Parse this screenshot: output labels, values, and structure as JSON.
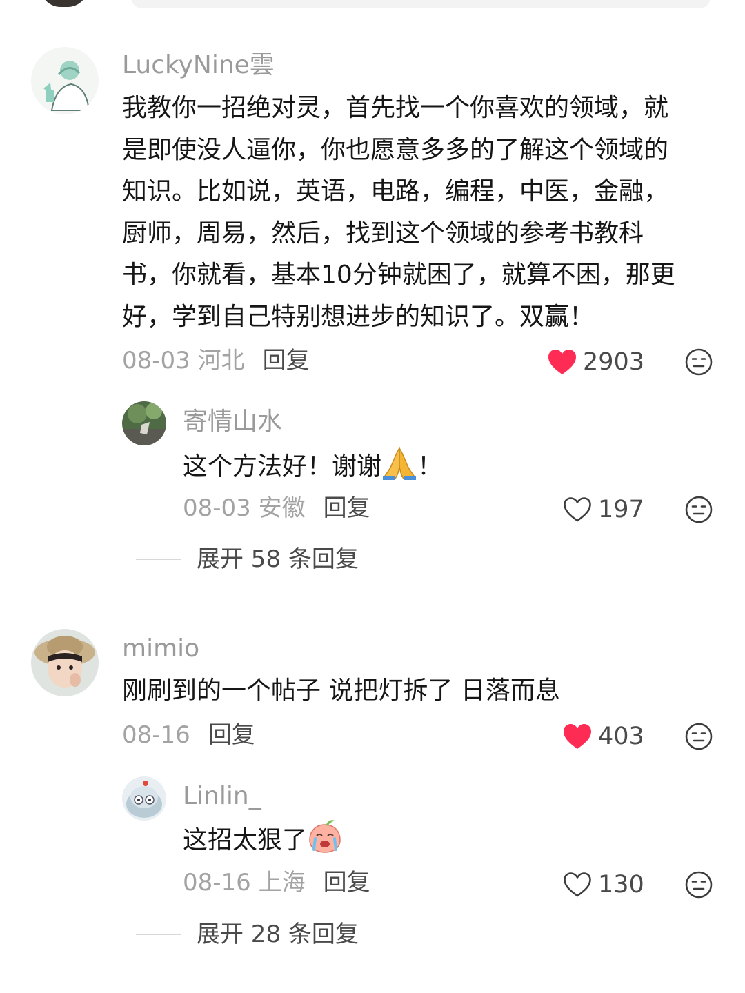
{
  "comments": [
    {
      "username": "LuckyNine雲",
      "lines": [
        "我教你一招绝对灵，首先找一个你喜欢的领域，就",
        "是即使没人逼你，你也愿意多多的了解这个领域的",
        "知识。比如说，英语，电路，编程，中医，金融，",
        "厨师，周易，然后，找到这个领域的参考书教科",
        "书，你就看，基本10分钟就困了，就算不困，那更",
        "好，学到自己特别想进步的知识了。双赢！"
      ],
      "date": "08-03 河北",
      "reply_label": "回复",
      "likes": "2903",
      "liked": true,
      "replies": [
        {
          "username": "寄情山水",
          "text_before_emoji": "这个方法好！谢谢",
          "emoji": "praying-hands",
          "text_after_emoji": "！",
          "date": "08-03 安徽",
          "reply_label": "回复",
          "likes": "197",
          "liked": false
        }
      ],
      "expand_label": "展开 58 条回复"
    },
    {
      "username": "mimio",
      "lines": [
        "刚刷到的一个帖子 说把灯拆了 日落而息"
      ],
      "date": "08-16",
      "reply_label": "回复",
      "likes": "403",
      "liked": true,
      "replies": [
        {
          "username": "Linlin_",
          "text_before_emoji": "这招太狠了",
          "emoji": "crying-peach",
          "text_after_emoji": "",
          "date": "08-16 上海",
          "reply_label": "回复",
          "likes": "130",
          "liked": false
        }
      ],
      "expand_label": "展开 28 条回复"
    }
  ],
  "colors": {
    "liked_heart": "#fe2c55",
    "username": "#9a9a9a",
    "text": "#161616",
    "meta": "#a3a3a3"
  }
}
